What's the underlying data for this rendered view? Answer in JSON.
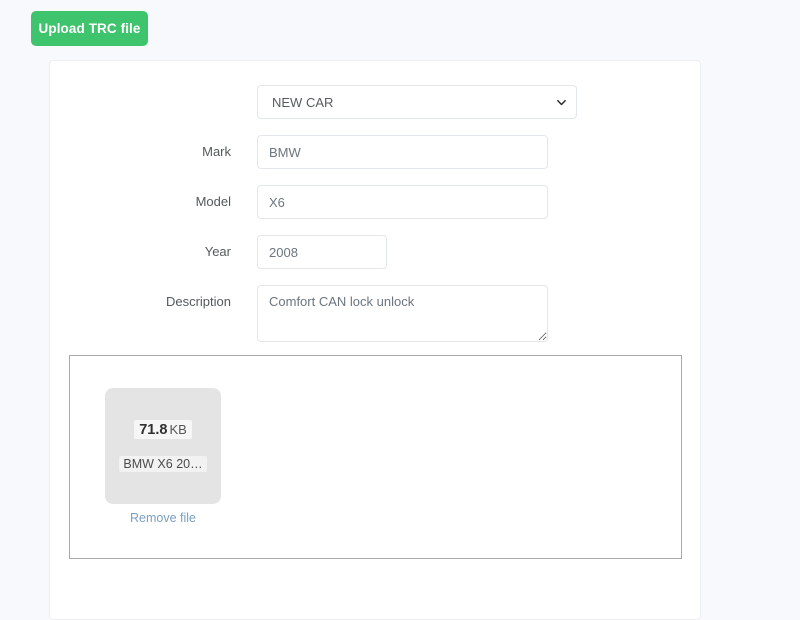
{
  "page": {
    "background_color": "#f8f9fc"
  },
  "toolbar": {
    "upload_button_label": "Upload TRC file",
    "upload_button_color": "#3dc46c"
  },
  "form": {
    "car_select": {
      "selected": "NEW CAR",
      "options": [
        "NEW CAR"
      ],
      "caret_icon": "chevron-down-icon"
    },
    "fields": [
      {
        "label": "Mark",
        "value": "BMW"
      },
      {
        "label": "Model",
        "value": "X6"
      },
      {
        "label": "Year",
        "value": "2008"
      },
      {
        "label": "Description",
        "value": "Comfort CAN lock unlock"
      }
    ]
  },
  "dropzone": {
    "file": {
      "size_number": "71.8",
      "size_unit": "KB",
      "name": "BMW X6 20…",
      "remove_label": "Remove file",
      "remove_link_color": "#7a9ec4"
    }
  }
}
